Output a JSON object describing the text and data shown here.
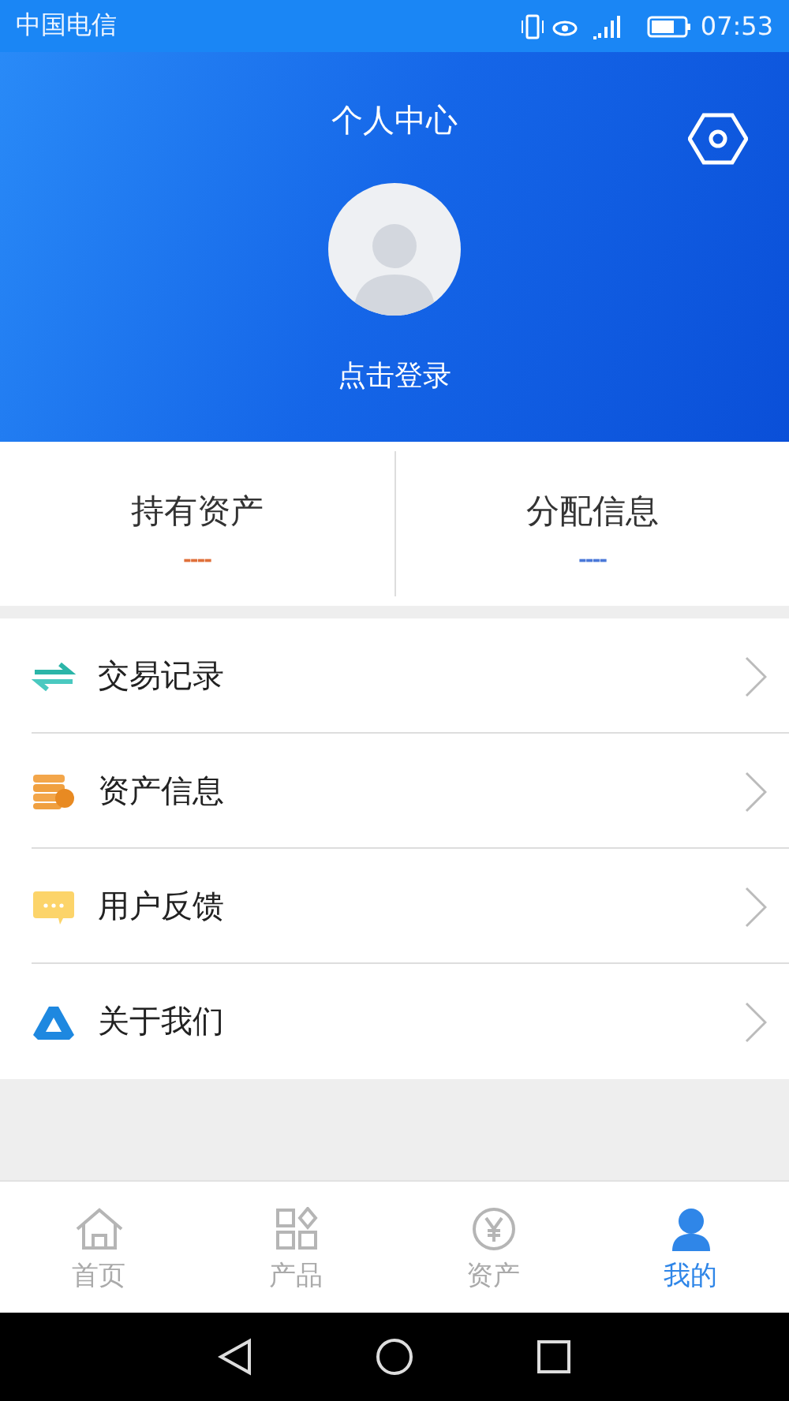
{
  "status_bar": {
    "carrier": "中国电信",
    "time": "07:53"
  },
  "header": {
    "title": "个人中心",
    "login": "点击登录"
  },
  "summary": [
    {
      "label": "持有资产",
      "value": "----",
      "color": "#e0703a"
    },
    {
      "label": "分配信息",
      "value": "----",
      "color": "#4a78d8"
    }
  ],
  "menu": [
    {
      "kind": "exchange",
      "label": "交易记录"
    },
    {
      "kind": "coins",
      "label": "资产信息"
    },
    {
      "kind": "chat",
      "label": "用户反馈"
    },
    {
      "kind": "logo",
      "label": "关于我们"
    }
  ],
  "tab_bar": [
    {
      "kind": "home",
      "label": "首页",
      "selected": false
    },
    {
      "kind": "grid",
      "label": "产品",
      "selected": false
    },
    {
      "kind": "yen",
      "label": "资产",
      "selected": false
    },
    {
      "kind": "user",
      "label": "我的",
      "selected": true
    }
  ]
}
